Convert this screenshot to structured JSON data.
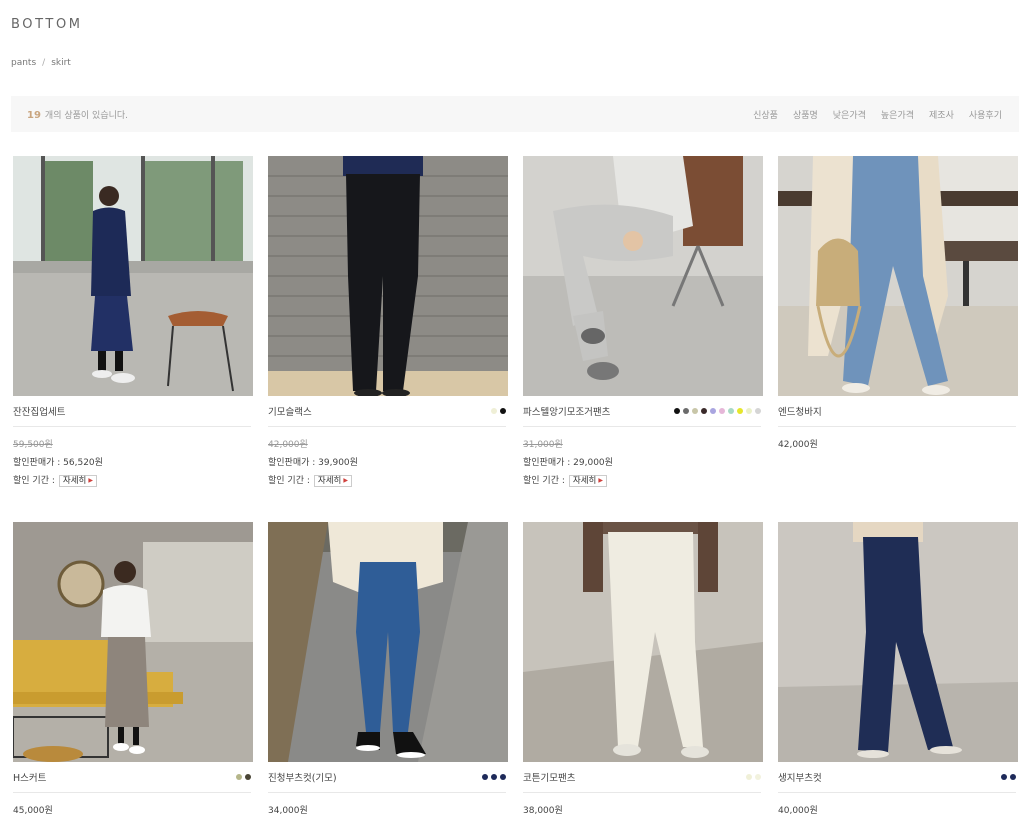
{
  "category": {
    "title": "BOTTOM",
    "subcategories": [
      "pants",
      "skirt"
    ],
    "separator": "/"
  },
  "toolbar": {
    "count_number": "19",
    "count_text": "개의 상품이 있습니다.",
    "sort_options": [
      "신상품",
      "상품명",
      "낮은가격",
      "높은가격",
      "제조사",
      "사용후기"
    ]
  },
  "products": [
    {
      "name": "잔잔집업세트",
      "original_price": "59,500원",
      "sale_label": "할인판매가 : 56,520원",
      "period_label": "할인 기간 :",
      "detail_label": "자세히",
      "swatches": []
    },
    {
      "name": "기모슬랙스",
      "original_price": "42,000원",
      "sale_label": "할인판매가 : 39,900원",
      "period_label": "할인 기간 :",
      "detail_label": "자세히",
      "swatches": [
        "#efefd6",
        "#111111"
      ]
    },
    {
      "name": "파스텔앙기모조거팬츠",
      "original_price": "31,000원",
      "sale_label": "할인판매가 : 29,000원",
      "period_label": "할인 기간 :",
      "detail_label": "자세히",
      "swatches": [
        "#111111",
        "#6b6b6b",
        "#c8c6a8",
        "#3a2a2a",
        "#a9a5e0",
        "#e5b7d8",
        "#a7d9c4",
        "#e6e62b",
        "#eaf0c8",
        "#d5d5d5"
      ]
    },
    {
      "name": "엔드청바지",
      "price": "42,000원",
      "swatches": []
    },
    {
      "name": "H스커트",
      "price": "45,000원",
      "swatches": [
        "#b5b68a",
        "#4a4536"
      ]
    },
    {
      "name": "진청부츠컷(기모)",
      "price": "34,000원",
      "swatches": [
        "#1e2a5a",
        "#1e2a5a",
        "#1e2a5a"
      ]
    },
    {
      "name": "코튼기모팬츠",
      "price": "38,000원",
      "swatches": [
        "#f0f0d8",
        "#f2f2de"
      ]
    },
    {
      "name": "생지부츠컷",
      "price": "40,000원",
      "swatches": [
        "#1e2a5a",
        "#1e2a5a"
      ]
    }
  ]
}
